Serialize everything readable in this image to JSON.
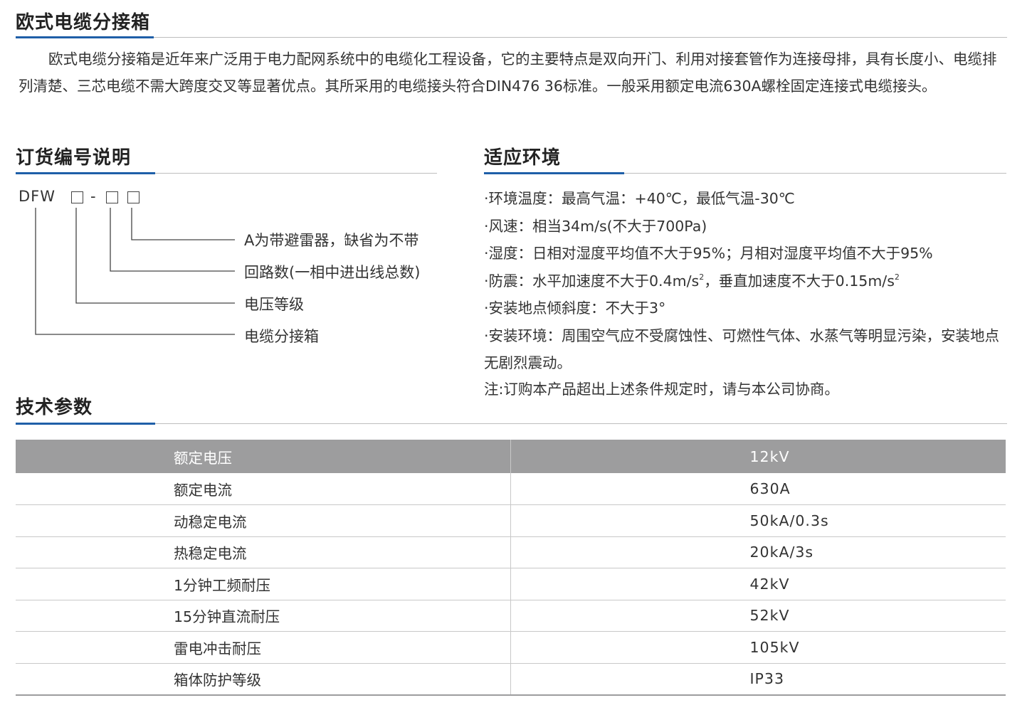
{
  "section1": {
    "title": "欧式电缆分接箱",
    "body": "欧式电缆分接箱是近年来广泛用于电力配网系统中的电缆化工程设备，它的主要特点是双向开门、利用对接套管作为连接母排，具有长度小、电缆排列清楚、三芯电缆不需大跨度交叉等显著优点。其所采用的电缆接头符合DIN476 36标准。一般采用额定电流630A螺栓固定连接式电缆接头。"
  },
  "ordering": {
    "title": "订货编号说明",
    "prefix": "DFW",
    "dash": "-",
    "labels": [
      "A为带避雷器，缺省为不带",
      "回路数(一相中进出线总数)",
      "电压等级",
      "电缆分接箱"
    ]
  },
  "environment": {
    "title": "适应环境",
    "items": [
      {
        "text": "·环境温度：最高气温：+40℃，最低气温-30℃"
      },
      {
        "text": "·风速：相当34m/s(不大于700Pa)"
      },
      {
        "text": "·湿度：日相对湿度平均值不大于95%；月相对湿度平均值不大于95%"
      },
      {
        "pre": "·防震：水平加速度不大于0.4m/s",
        "sup1": "2",
        "mid": "，垂直加速度不大于0.15m/s",
        "sup2": "2"
      },
      {
        "text": "·安装地点倾斜度：不大于3°"
      },
      {
        "text": "·安装环境：周围空气应不受腐蚀性、可燃性气体、水蒸气等明显污染，安装地点无剧烈震动。"
      }
    ],
    "note": "注:订购本产品超出上述条件规定时，请与本公司协商。"
  },
  "tech": {
    "title": "技术参数",
    "header": {
      "param": "额定电压",
      "value": "12kV"
    },
    "rows": [
      {
        "param": "额定电流",
        "value": "630A"
      },
      {
        "param": "动稳定电流",
        "value": "50kA/0.3s"
      },
      {
        "param": "热稳定电流",
        "value": "20kA/3s"
      },
      {
        "param": "1分钟工频耐压",
        "value": "42kV"
      },
      {
        "param": "15分钟直流耐压",
        "value": "52kV"
      },
      {
        "param": "雷电冲击耐压",
        "value": "105kV"
      },
      {
        "param": "箱体防护等级",
        "value": "IP33"
      }
    ]
  },
  "colors": {
    "accent": "#1f5fa8",
    "table_header": "#9d9d9e",
    "rule": "#bdbdbd"
  }
}
